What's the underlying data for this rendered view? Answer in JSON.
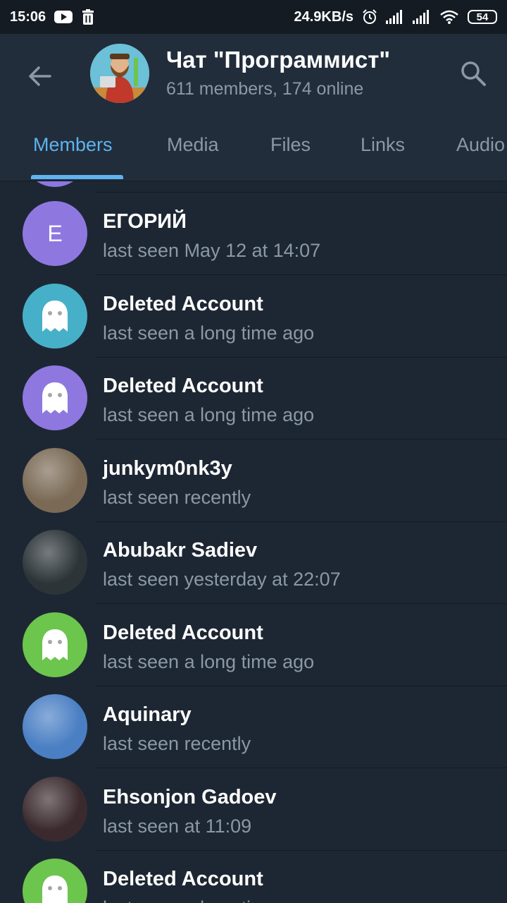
{
  "status_bar": {
    "time": "15:06",
    "speed": "24.9KB/s",
    "battery": "54"
  },
  "header": {
    "title": "Чат \"Программист\"",
    "subtitle": "611 members, 174 online"
  },
  "tabs": [
    "Members",
    "Media",
    "Files",
    "Links",
    "Audio"
  ],
  "colors": {
    "background": "#1d2733",
    "header": "#212d3b",
    "accent": "#5fb3ee",
    "secondary_text": "#8b98a6"
  },
  "members": [
    {
      "name": "ЕГОРИЙ",
      "status": "last seen May 12 at 14:07",
      "initial": "E",
      "avatar": "initial-letter",
      "color": "#8e78e0"
    },
    {
      "name": "Deleted Account",
      "status": "last seen a long time ago",
      "avatar": "ghost-icon",
      "color": "#47b0c9"
    },
    {
      "name": "Deleted Account",
      "status": "last seen a long time ago",
      "avatar": "ghost-icon",
      "color": "#8e78e0"
    },
    {
      "name": "junkym0nk3y",
      "status": "last seen recently",
      "avatar": "photo-man-with-headband",
      "color": "#7a6a55"
    },
    {
      "name": "Abubakr Sadiev",
      "status": "last seen yesterday at 22:07",
      "avatar": "photo-tower-night",
      "color": "#2c3438"
    },
    {
      "name": "Deleted Account",
      "status": "last seen a long time ago",
      "avatar": "ghost-icon",
      "color": "#6cc54d"
    },
    {
      "name": "Aquinary",
      "status": "last seen recently",
      "avatar": "photo-anime-girl",
      "color": "#4a7fc4"
    },
    {
      "name": "Ehsonjon Gadoev",
      "status": "last seen at 11:09",
      "avatar": "photo-red-glitch",
      "color": "#3a2a2e"
    },
    {
      "name": "Deleted Account",
      "status": "last seen a long time ago",
      "avatar": "ghost-icon",
      "color": "#6cc54d"
    }
  ]
}
